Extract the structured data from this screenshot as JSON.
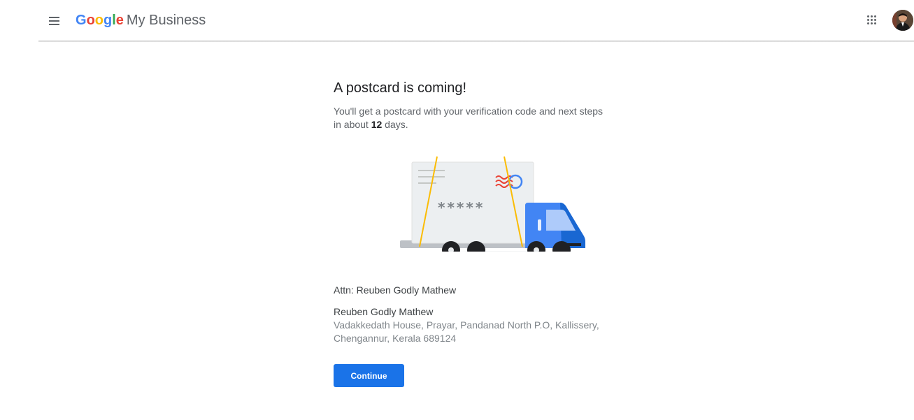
{
  "header": {
    "menu_icon": "hamburger-menu-icon",
    "logo_letters": [
      {
        "char": "G",
        "color": "#4285F4"
      },
      {
        "char": "o",
        "color": "#EA4335"
      },
      {
        "char": "o",
        "color": "#FBBC05"
      },
      {
        "char": "g",
        "color": "#4285F4"
      },
      {
        "char": "l",
        "color": "#34A853"
      },
      {
        "char": "e",
        "color": "#EA4335"
      }
    ],
    "product_name": "My Business",
    "apps_icon": "apps-grid-icon",
    "avatar_icon": "user-avatar"
  },
  "main": {
    "title": "A postcard is coming!",
    "subtitle_before": "You'll get a postcard with your verification code and next steps in about ",
    "subtitle_days": "12",
    "subtitle_after": " days.",
    "illustration": {
      "name": "postcard-truck-illustration",
      "code_mask": "*****"
    },
    "attn": "Attn: Reuben Godly Mathew",
    "address_name": "Reuben Godly Mathew",
    "address_line": "Vadakkedath House, Prayar, Pandanad North P.O, Kallissery, Chengannur, Kerala 689124",
    "continue_label": "Continue",
    "accent_color": "#1a73e8"
  }
}
